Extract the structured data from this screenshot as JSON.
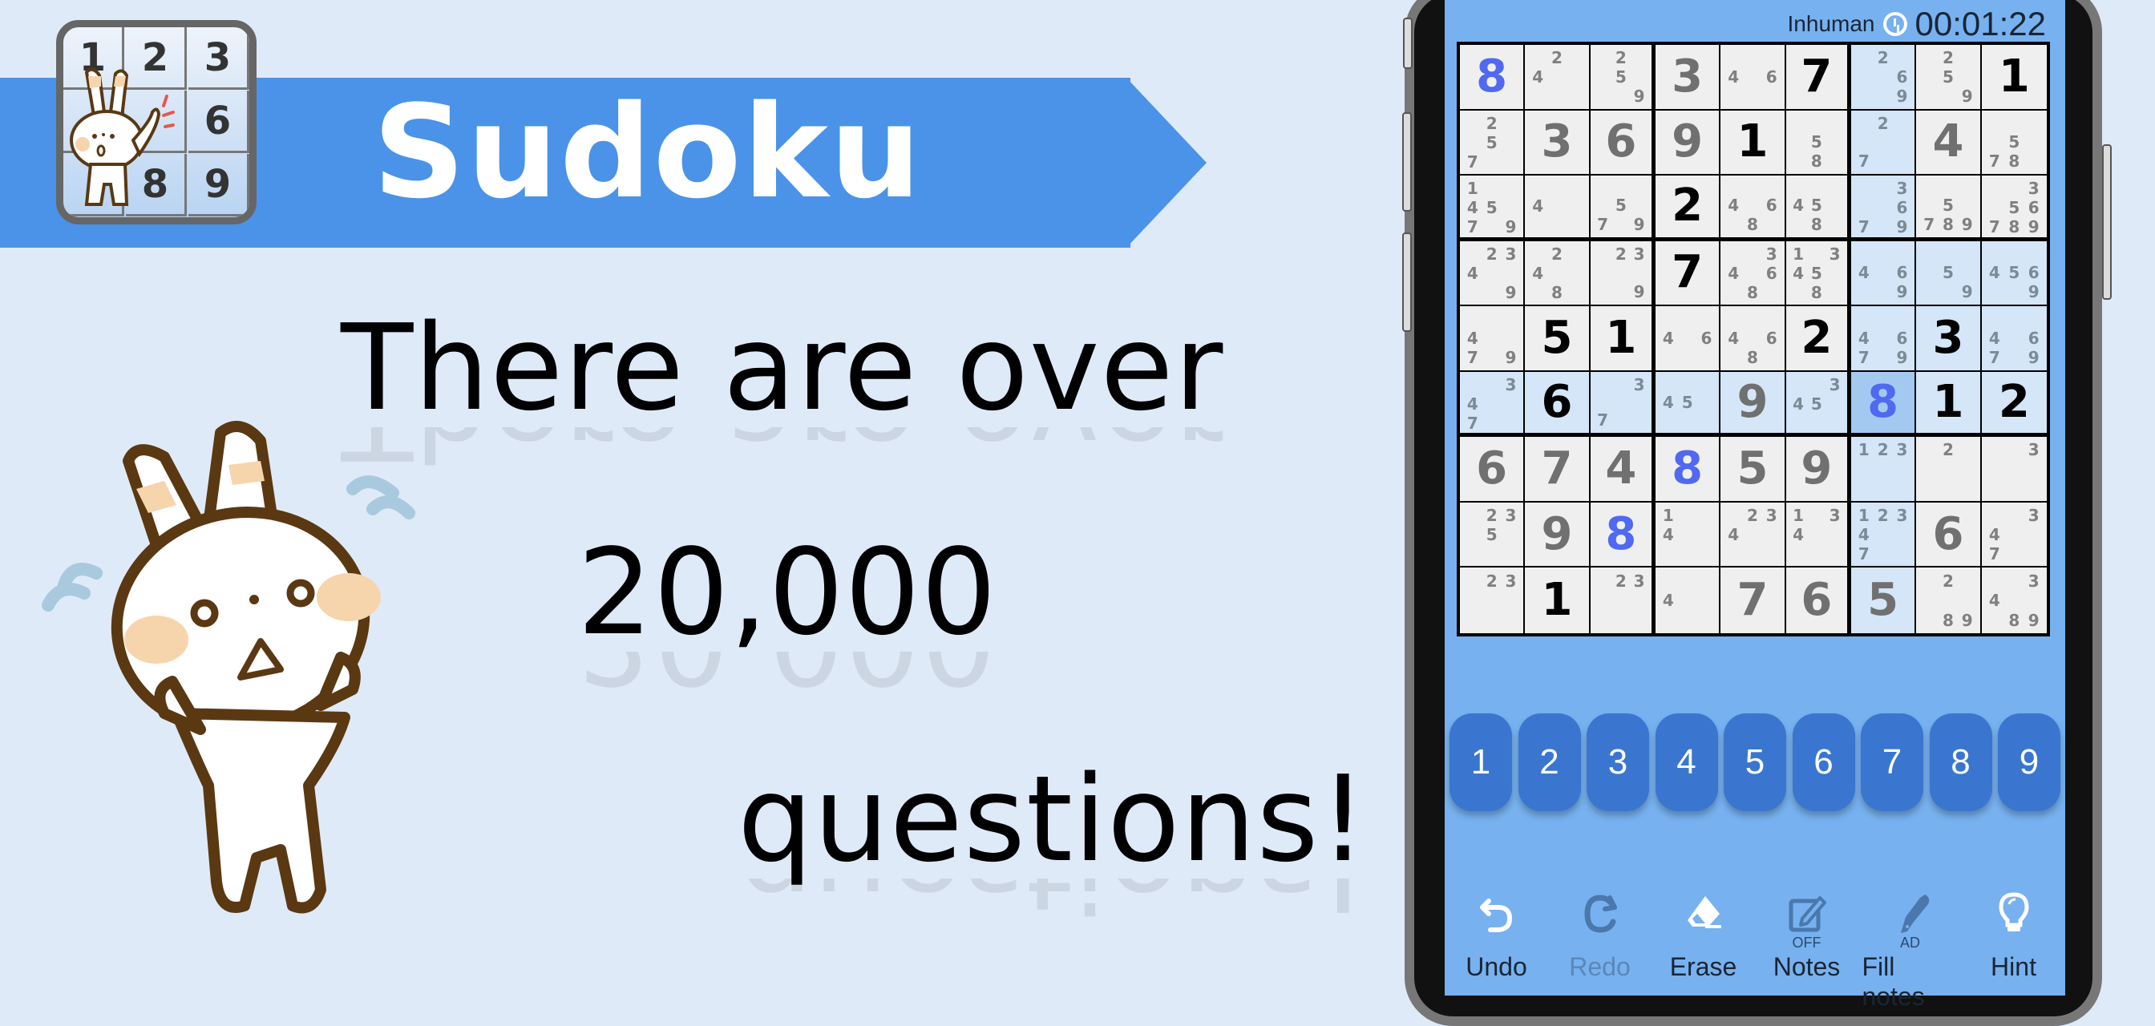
{
  "promo": {
    "title": "Sudoku",
    "headline_lines": [
      "There are over",
      "20,000",
      "questions!"
    ],
    "app_icon_digits": [
      "1",
      "2",
      "3",
      "",
      "",
      "6",
      "",
      "8",
      "9"
    ]
  },
  "game": {
    "difficulty": "Inhuman",
    "timer": "00:01:22",
    "selected_cell": {
      "row": 6,
      "col": 7
    },
    "colors": {
      "screen_bg": "#77b1f0",
      "cell_bg": "#efefef",
      "highlight": "#d4e6f8",
      "selected": "#a3c9f1",
      "given_digit": "#000000",
      "user_digit": "#707070",
      "match_digit": "#5168f0",
      "key_bg": "#3a76d0",
      "banner": "#4a93e8",
      "page_bg": "#dfeaf8"
    },
    "grid": [
      [
        {
          "v": "8",
          "t": "blue"
        },
        {
          "n": [
            2,
            4
          ]
        },
        {
          "n": [
            2,
            5,
            9
          ]
        },
        {
          "v": "3",
          "t": "user"
        },
        {
          "n": [
            4,
            6
          ]
        },
        {
          "v": "7",
          "t": "given"
        },
        {
          "n": [
            2,
            6,
            9
          ]
        },
        {
          "n": [
            2,
            5,
            9
          ]
        },
        {
          "v": "1",
          "t": "given"
        }
      ],
      [
        {
          "n": [
            2,
            5,
            7
          ]
        },
        {
          "v": "3",
          "t": "user"
        },
        {
          "v": "6",
          "t": "user"
        },
        {
          "v": "9",
          "t": "user"
        },
        {
          "v": "1",
          "t": "given"
        },
        {
          "n": [
            5,
            8
          ]
        },
        {
          "n": [
            2,
            7
          ]
        },
        {
          "v": "4",
          "t": "user"
        },
        {
          "n": [
            5,
            7,
            8
          ]
        }
      ],
      [
        {
          "n": [
            1,
            4,
            5,
            7,
            9
          ]
        },
        {
          "n": [
            4
          ]
        },
        {
          "n": [
            5,
            7,
            9
          ]
        },
        {
          "v": "2",
          "t": "given"
        },
        {
          "n": [
            4,
            6,
            8
          ]
        },
        {
          "n": [
            4,
            5,
            8
          ]
        },
        {
          "n": [
            3,
            6,
            7,
            9
          ]
        },
        {
          "n": [
            5,
            7,
            8,
            9
          ]
        },
        {
          "n": [
            3,
            5,
            6,
            7,
            8,
            9
          ]
        }
      ],
      [
        {
          "n": [
            2,
            3,
            4,
            9
          ]
        },
        {
          "n": [
            2,
            4,
            8
          ]
        },
        {
          "n": [
            2,
            3,
            9
          ]
        },
        {
          "v": "7",
          "t": "given"
        },
        {
          "n": [
            3,
            4,
            6,
            8
          ]
        },
        {
          "n": [
            1,
            3,
            4,
            5,
            8
          ]
        },
        {
          "n": [
            4,
            6,
            9
          ]
        },
        {
          "n": [
            5,
            9
          ]
        },
        {
          "n": [
            4,
            5,
            6,
            9
          ]
        }
      ],
      [
        {
          "n": [
            4,
            7,
            9
          ]
        },
        {
          "v": "5",
          "t": "given"
        },
        {
          "v": "1",
          "t": "given"
        },
        {
          "n": [
            4,
            6
          ]
        },
        {
          "n": [
            4,
            6,
            8
          ]
        },
        {
          "v": "2",
          "t": "given"
        },
        {
          "n": [
            4,
            6,
            7,
            9
          ]
        },
        {
          "v": "3",
          "t": "given"
        },
        {
          "n": [
            4,
            6,
            7,
            9
          ]
        }
      ],
      [
        {
          "n": [
            3,
            4,
            7
          ]
        },
        {
          "v": "6",
          "t": "given"
        },
        {
          "n": [
            3,
            7
          ]
        },
        {
          "n": [
            4,
            5
          ]
        },
        {
          "v": "9",
          "t": "user"
        },
        {
          "n": [
            3,
            4,
            5
          ]
        },
        {
          "v": "8",
          "t": "blue"
        },
        {
          "v": "1",
          "t": "given"
        },
        {
          "v": "2",
          "t": "given"
        }
      ],
      [
        {
          "v": "6",
          "t": "user"
        },
        {
          "v": "7",
          "t": "user"
        },
        {
          "v": "4",
          "t": "user"
        },
        {
          "v": "8",
          "t": "blue"
        },
        {
          "v": "5",
          "t": "user"
        },
        {
          "v": "9",
          "t": "user"
        },
        {
          "n": [
            1,
            2,
            3
          ]
        },
        {
          "n": [
            2
          ]
        },
        {
          "n": [
            3
          ]
        }
      ],
      [
        {
          "n": [
            2,
            3,
            5
          ]
        },
        {
          "v": "9",
          "t": "user"
        },
        {
          "v": "8",
          "t": "blue"
        },
        {
          "n": [
            1,
            4
          ]
        },
        {
          "n": [
            2,
            3,
            4
          ]
        },
        {
          "n": [
            1,
            3,
            4
          ]
        },
        {
          "n": [
            1,
            2,
            3,
            4,
            7
          ]
        },
        {
          "v": "6",
          "t": "user"
        },
        {
          "n": [
            3,
            4,
            7
          ]
        }
      ],
      [
        {
          "n": [
            2,
            3
          ]
        },
        {
          "v": "1",
          "t": "given"
        },
        {
          "n": [
            2,
            3
          ]
        },
        {
          "n": [
            4
          ]
        },
        {
          "v": "7",
          "t": "user"
        },
        {
          "v": "6",
          "t": "user"
        },
        {
          "v": "5",
          "t": "user"
        },
        {
          "n": [
            2,
            8,
            9
          ]
        },
        {
          "n": [
            3,
            4,
            8,
            9
          ]
        }
      ]
    ],
    "numpad": [
      "1",
      "2",
      "3",
      "4",
      "5",
      "6",
      "7",
      "8",
      "9"
    ],
    "toolbar": [
      {
        "id": "undo",
        "label": "Undo",
        "icon": "undo-icon",
        "sub": "",
        "enabled": true
      },
      {
        "id": "redo",
        "label": "Redo",
        "icon": "redo-icon",
        "sub": "",
        "enabled": false
      },
      {
        "id": "erase",
        "label": "Erase",
        "icon": "eraser-icon",
        "sub": "",
        "enabled": true
      },
      {
        "id": "notes",
        "label": "Notes",
        "icon": "pencil-note-icon",
        "sub": "OFF",
        "enabled": true
      },
      {
        "id": "fill-notes",
        "label": "Fill notes",
        "icon": "pen-nib-icon",
        "sub": "AD",
        "enabled": true
      },
      {
        "id": "hint",
        "label": "Hint",
        "icon": "lightbulb-icon",
        "sub": "",
        "enabled": true
      }
    ]
  }
}
